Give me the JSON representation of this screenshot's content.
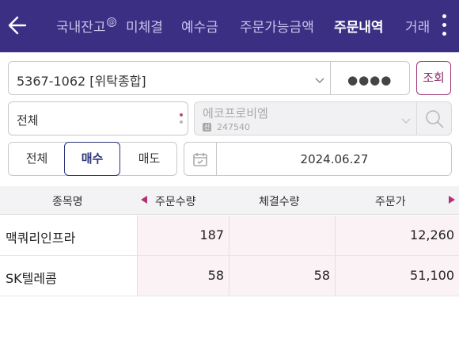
{
  "header": {
    "tabs": [
      {
        "label": "국내잔고"
      },
      {
        "label": "미체결"
      },
      {
        "label": "예수금"
      },
      {
        "label": "주문가능금액"
      },
      {
        "label": "주문내역"
      },
      {
        "label": "거래"
      }
    ],
    "active_tab": "주문내역",
    "tab_badge": "@",
    "colors": {
      "header_bg": "#3a2f83",
      "accent": "#9e3a78"
    }
  },
  "account": {
    "number": "5367-1062 [위탁종합]",
    "password_mask": "●●●●",
    "query_label": "조회"
  },
  "filters": {
    "market": "전체",
    "stock_name": "에코프로비엠",
    "stock_code_badge": "신",
    "stock_code": "247540",
    "side_options": [
      {
        "label": "전체"
      },
      {
        "label": "매수"
      },
      {
        "label": "매도"
      }
    ],
    "side_selected": "매수",
    "date": "2024.06.27"
  },
  "table": {
    "headers": {
      "name": "종목명",
      "order_qty": "주문수량",
      "exec_qty": "체결수량",
      "order_price": "주문가"
    },
    "rows": [
      {
        "name": "맥쿼리인프라",
        "order_qty": "187",
        "exec_qty": "",
        "order_price": "12,260"
      },
      {
        "name": "SK텔레콤",
        "order_qty": "58",
        "exec_qty": "58",
        "order_price": "51,100"
      }
    ]
  }
}
